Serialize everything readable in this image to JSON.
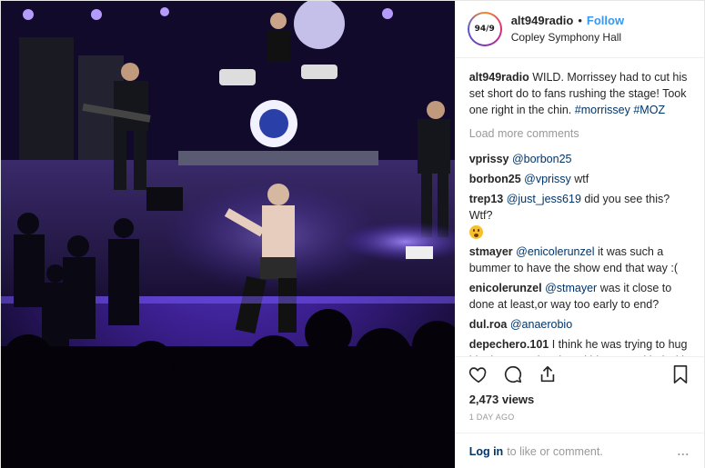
{
  "header": {
    "username": "alt949radio",
    "follow_label": "Follow",
    "location": "Copley Symphony Hall",
    "avatar_logo": "94/9"
  },
  "caption": {
    "username": "alt949radio",
    "text": "WILD. Morrissey had to cut his set short do to fans rushing the stage! Took one right in the chin.",
    "hashtags": "#morrissey #MOZ"
  },
  "load_more_label": "Load more comments",
  "comments": [
    {
      "user": "vprissy",
      "mention": "@borbon25",
      "text": ""
    },
    {
      "user": "borbon25",
      "mention": "@vprissy",
      "text": "wtf"
    },
    {
      "user": "trep13",
      "mention": "@just_jess619",
      "text": "did you see this? Wtf?"
    },
    {
      "user": "stmayer",
      "mention": "@enicolerunzel",
      "text": "it was such a bummer to have the show end that way :("
    },
    {
      "user": "enicolerunzel",
      "mention": "@stmayer",
      "text": "was it close to done at least,or way too early to end?"
    },
    {
      "user": "dul.roa",
      "mention": "@anaerobio",
      "text": ""
    },
    {
      "user": "depechero.101",
      "mention": "",
      "text": "I think he was trying to hug him but security tripped him up and led with his fist still they are freaking idiots shows some class SD"
    }
  ],
  "views": "2,473 views",
  "date": "1 DAY AGO",
  "login": {
    "link": "Log in",
    "text": "to like or comment.",
    "more": "..."
  },
  "icons": {
    "like": "heart-icon",
    "comment": "comment-icon",
    "share": "share-icon",
    "save": "bookmark-icon"
  },
  "colors": {
    "follow": "#3897f0",
    "link": "#003569",
    "muted": "#999999",
    "stage_light": "#6b3cff"
  }
}
